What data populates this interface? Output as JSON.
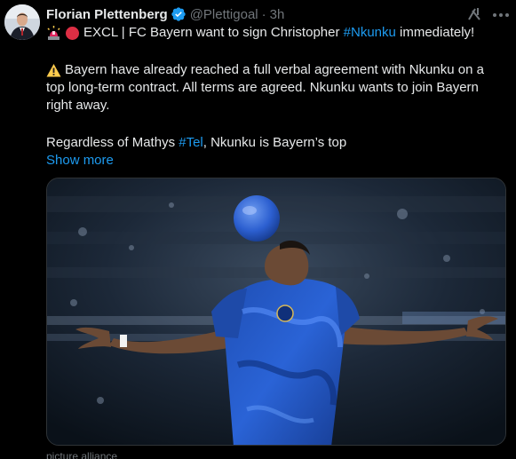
{
  "author": {
    "name": "Florian Plettenberg",
    "handle": "@Plettigoal",
    "time": "3h",
    "separator": "·"
  },
  "icons": {
    "verified": "verified-badge-icon",
    "grok": "grok-icon",
    "more": "more-options-icon"
  },
  "tweet": {
    "line1_prefix": "EXCL | FC Bayern want to sign Christopher ",
    "line1_hashtag": "#Nkunku",
    "line1_suffix": " immediately!",
    "line2": "Bayern have already reached a full verbal agreement with Nkunku on a",
    "line3": "top long-term contract. All terms are agreed. Nkunku wants to join Bayern",
    "line4": "right away.",
    "line5_prefix": "Regardless of Mathys ",
    "line5_hashtag": "#Tel",
    "line5_suffix": ", Nkunku is Bayern’s top",
    "show_more": "Show more"
  },
  "media": {
    "credit": "picture alliance"
  },
  "colors": {
    "background": "#000000",
    "text": "#e7e9ea",
    "muted": "#71767b",
    "link": "#1d9bf0",
    "verified": "#1d9bf0",
    "border": "#2f3336"
  }
}
